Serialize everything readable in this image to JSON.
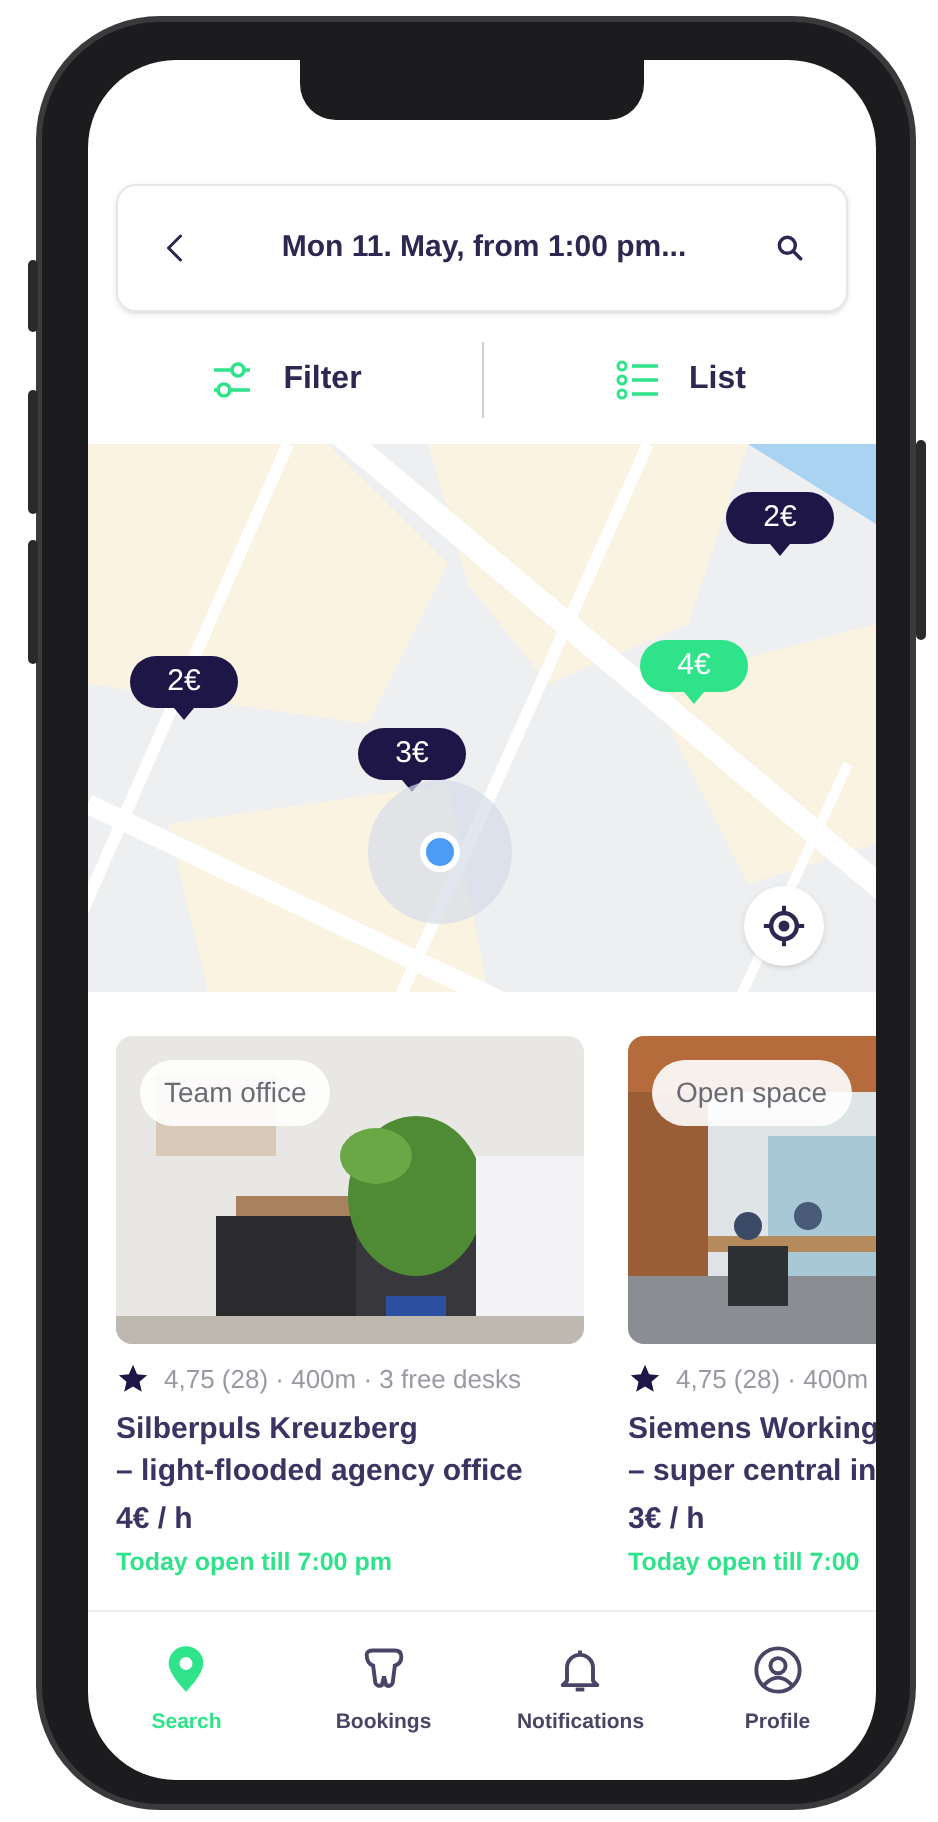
{
  "search_bar": {
    "text": "Mon 11. May, from 1:00 pm..."
  },
  "toolbar": [
    {
      "kind": "filter",
      "label": "Filter"
    },
    {
      "kind": "list",
      "label": "List"
    }
  ],
  "map": {
    "kind": "picture",
    "pins": [
      {
        "label": "2€",
        "selected": false
      },
      {
        "label": "4€",
        "selected": true
      },
      {
        "label": "2€",
        "selected": false
      },
      {
        "label": "3€",
        "selected": false
      }
    ]
  },
  "cards": [
    {
      "tag": "Team office",
      "info": "4,75 (28) · 400m · 3 free desks",
      "title_lines": [
        "Silberpuls Kreuzberg",
        "– light-flooded agency office"
      ],
      "price": "4€ / h",
      "hours": "Today open till 7:00 pm"
    },
    {
      "tag": "Open space",
      "info": "4,75 (28) · 400m",
      "title_lines": [
        "Siemens Working",
        "– super central in"
      ],
      "price": "3€ / h",
      "hours": "Today open till 7:00"
    }
  ],
  "nav": [
    {
      "kind": "search",
      "label": "Search",
      "selected": true
    },
    {
      "kind": "bookings",
      "label": "Bookings",
      "selected": false
    },
    {
      "kind": "notifications",
      "label": "Notifications",
      "selected": false
    },
    {
      "kind": "profile",
      "label": "Profile",
      "selected": false
    }
  ]
}
